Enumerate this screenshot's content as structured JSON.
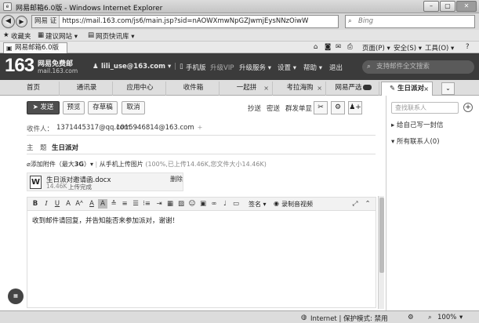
{
  "window": {
    "title": "网易邮箱6.0版 - Windows Internet Explorer"
  },
  "addressbar": {
    "security_label": "网易 证",
    "url": "https://mail.163.com/js6/main.jsp?sid=nAOWXmwNpGZJwmjEysNNzOiwW",
    "search_placeholder": "Bing"
  },
  "favorites": {
    "label": "收藏夹",
    "items": [
      "建议网站 ▾",
      "网页快讯库 ▾"
    ]
  },
  "commandbar": {
    "page_tab": "网易邮箱6.0版",
    "page_menu": "页面(P) ▾",
    "safety_menu": "安全(S) ▾",
    "tools_menu": "工具(O) ▾"
  },
  "header": {
    "logo": "163",
    "brand": "网易免费邮",
    "brand_url": "mail.163.com",
    "user": "lili_use@163.com ▾",
    "links": {
      "mobile": "手机版",
      "vip": "升级VIP",
      "upgrade": "升级服务 ▾",
      "settings": "设置 ▾",
      "help": "帮助 ▾",
      "logout": "退出"
    },
    "search_placeholder": "支持邮件全文搜索"
  },
  "tabs": [
    {
      "label": "首页",
      "closable": false,
      "active": false,
      "badge": false
    },
    {
      "label": "通讯录",
      "closable": false,
      "active": false,
      "badge": false
    },
    {
      "label": "应用中心",
      "closable": false,
      "active": false,
      "badge": false
    },
    {
      "label": "收件箱",
      "closable": false,
      "active": false,
      "badge": false
    },
    {
      "label": "一起拼",
      "closable": true,
      "active": false,
      "badge": false
    },
    {
      "label": "考拉海购",
      "closable": true,
      "active": false,
      "badge": false
    },
    {
      "label": "网易严选",
      "closable": false,
      "active": false,
      "badge": true
    },
    {
      "label": "生日派对",
      "closable": true,
      "active": true,
      "badge": false
    }
  ],
  "toolbar": {
    "send": "发送",
    "preview": "预览",
    "save_draft": "存草稿",
    "cancel": "取消",
    "cc": "抄送",
    "bcc": "密送",
    "separate_send": "群发单显"
  },
  "compose": {
    "to_label": "收件人：",
    "recipients": [
      "1371445317@qq.com",
      "1015946814@163.com"
    ],
    "subject_label": "主　题",
    "subject": "生日派对",
    "attach_label": "添加附件（最大",
    "attach_size": "3G",
    "attach_close": "）▾",
    "phone_upload": "从手机上传图片",
    "upload_status": "(100%,已上传14.46K,您文件大小14.46K)",
    "attachment": {
      "filename": "生日派对邀请函.docx",
      "size": "14.46K",
      "status": "上传完成",
      "delete": "删除"
    },
    "signature": "签名 ▾",
    "record": "录制音视频",
    "body": "收到邮件请回复，并告知能否来参加派对，谢谢！"
  },
  "sidebar": {
    "search_placeholder": "查找联系人",
    "write_self": "给自己写一封信",
    "all_contacts": "所有联系人(0)"
  },
  "statusbar": {
    "zone": "Internet | 保护模式: 禁用",
    "zoom": "100%"
  }
}
